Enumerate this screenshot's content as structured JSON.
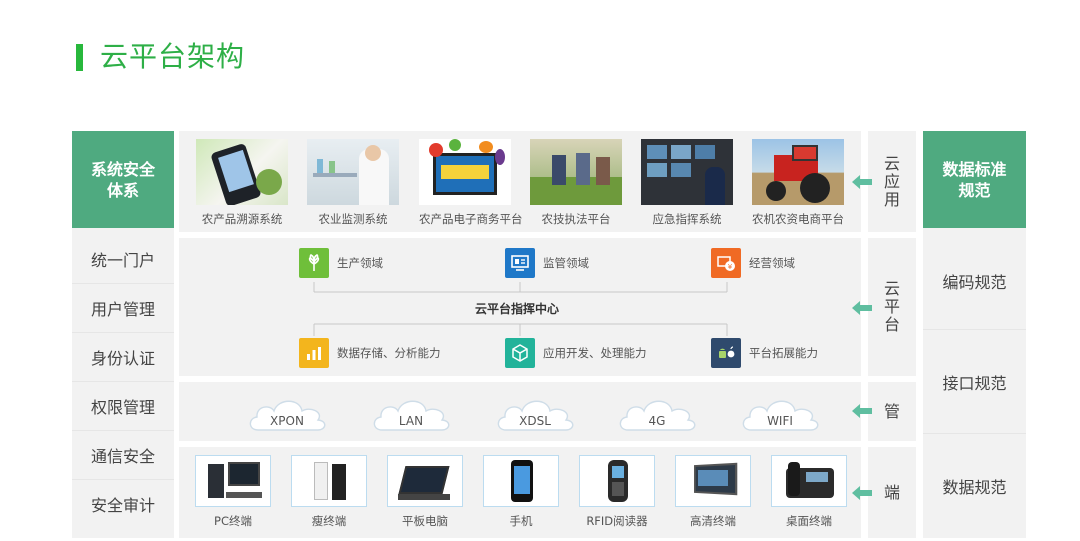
{
  "title": "云平台架构",
  "colors": {
    "accent_green": "#4faa80",
    "title_green": "#2eaf47",
    "panel_bg": "#f2f2f2",
    "arrow": "#5fbea0"
  },
  "left": {
    "header": "系统安全体系",
    "items": [
      "统一门户",
      "用户管理",
      "身份认证",
      "权限管理",
      "通信安全",
      "安全审计"
    ]
  },
  "right": {
    "header": "数据标准规范",
    "items": [
      "编码规范",
      "接口规范",
      "数据规范"
    ]
  },
  "layers": {
    "app": {
      "label": "云应用",
      "items": [
        "农产品溯源系统",
        "农业监测系统",
        "农产品电子商务平台",
        "农技执法平台",
        "应急指挥系统",
        "农机农资电商平台"
      ]
    },
    "platform": {
      "label": "云平台",
      "center": "云平台指挥中心",
      "top": [
        {
          "label": "生产领域",
          "icon": "wheat-icon",
          "color": "#6fbf3a"
        },
        {
          "label": "监管领域",
          "icon": "monitor-icon",
          "color": "#1f78c8"
        },
        {
          "label": "经营领域",
          "icon": "money-icon",
          "color": "#f06a24"
        }
      ],
      "bottom": [
        {
          "label": "数据存储、分析能力",
          "icon": "data-icon",
          "color": "#f3b51d"
        },
        {
          "label": "应用开发、处理能力",
          "icon": "box-icon",
          "color": "#22b39a"
        },
        {
          "label": "平台拓展能力",
          "icon": "android-apple-icon",
          "color": "#2f4a6d"
        }
      ]
    },
    "network": {
      "label": "管",
      "items": [
        "XPON",
        "LAN",
        "XDSL",
        "4G",
        "WIFI"
      ]
    },
    "terminal": {
      "label": "端",
      "items": [
        "PC终端",
        "瘦终端",
        "平板电脑",
        "手机",
        "RFID阅读器",
        "高清终端",
        "桌面终端"
      ]
    }
  }
}
